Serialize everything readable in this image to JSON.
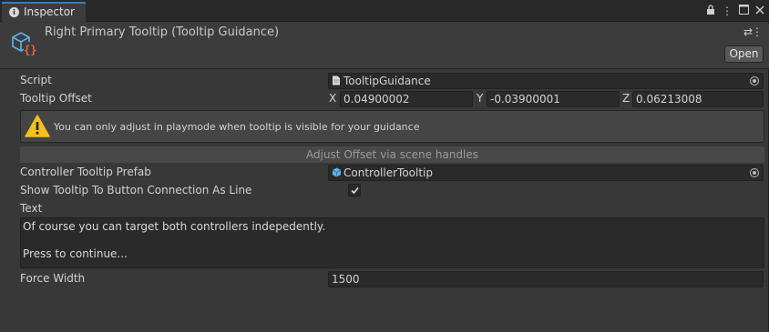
{
  "tab": {
    "label": "Inspector",
    "tools": [
      "lock-icon",
      "more-icon",
      "maximize-icon",
      "close-icon"
    ]
  },
  "header": {
    "title": "Right Primary Tooltip (Tooltip Guidance)",
    "open_label": "Open"
  },
  "properties": {
    "script": {
      "label": "Script",
      "value": "TooltipGuidance"
    },
    "tooltip_offset": {
      "label": "Tooltip Offset",
      "x_label": "X",
      "x": "0.04900002",
      "y_label": "Y",
      "y": "-0.03900001",
      "z_label": "Z",
      "z": "0.06213008"
    },
    "help": {
      "text": "You can only adjust in playmode when tooltip is visible for your guidance"
    },
    "adjust_button": "Adjust Offset via scene handles",
    "controller_prefab": {
      "label": "Controller Tooltip Prefab",
      "value": "ControllerTooltip"
    },
    "show_connection": {
      "label": "Show Tooltip To Button Connection As Line",
      "checked": true
    },
    "text": {
      "label": "Text",
      "lines": [
        "Of course you can target both controllers indepedently.",
        "",
        "Press to continue..."
      ]
    },
    "force_width": {
      "label": "Force Width",
      "value": "1500"
    }
  },
  "colors": {
    "accent": "#3a79bb",
    "warning": "#f4c21b",
    "prefab_icon": "#5fb3e8"
  }
}
